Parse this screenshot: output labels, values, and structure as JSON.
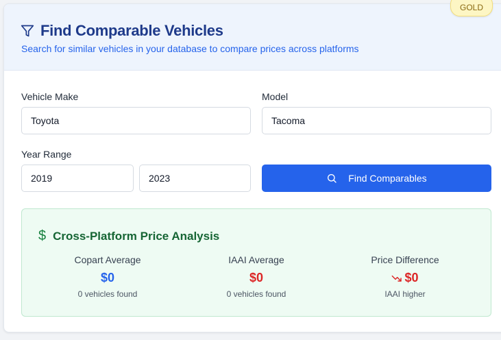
{
  "badge": "GOLD",
  "header": {
    "title": "Find Comparable Vehicles",
    "subtitle": "Search for similar vehicles in your database to compare prices across platforms"
  },
  "form": {
    "make_label": "Vehicle Make",
    "make_value": "Toyota",
    "model_label": "Model",
    "model_value": "Tacoma",
    "year_label": "Year Range",
    "year_from": "2019",
    "year_to": "2023",
    "button_label": "Find Comparables"
  },
  "analysis": {
    "title": "Cross-Platform Price Analysis",
    "stats": [
      {
        "label": "Copart Average",
        "value": "$0",
        "sub": "0 vehicles found",
        "color": "#2563eb"
      },
      {
        "label": "IAAI Average",
        "value": "$0",
        "sub": "0 vehicles found",
        "color": "#dc2626"
      },
      {
        "label": "Price Difference",
        "value": "$0",
        "sub": "IAAI higher",
        "color": "#dc2626",
        "icon": "trending-down-icon"
      }
    ]
  },
  "colors": {
    "accent": "#2563eb",
    "title": "#1e3a8a",
    "success_bg": "#eefbf3",
    "danger": "#dc2626"
  }
}
